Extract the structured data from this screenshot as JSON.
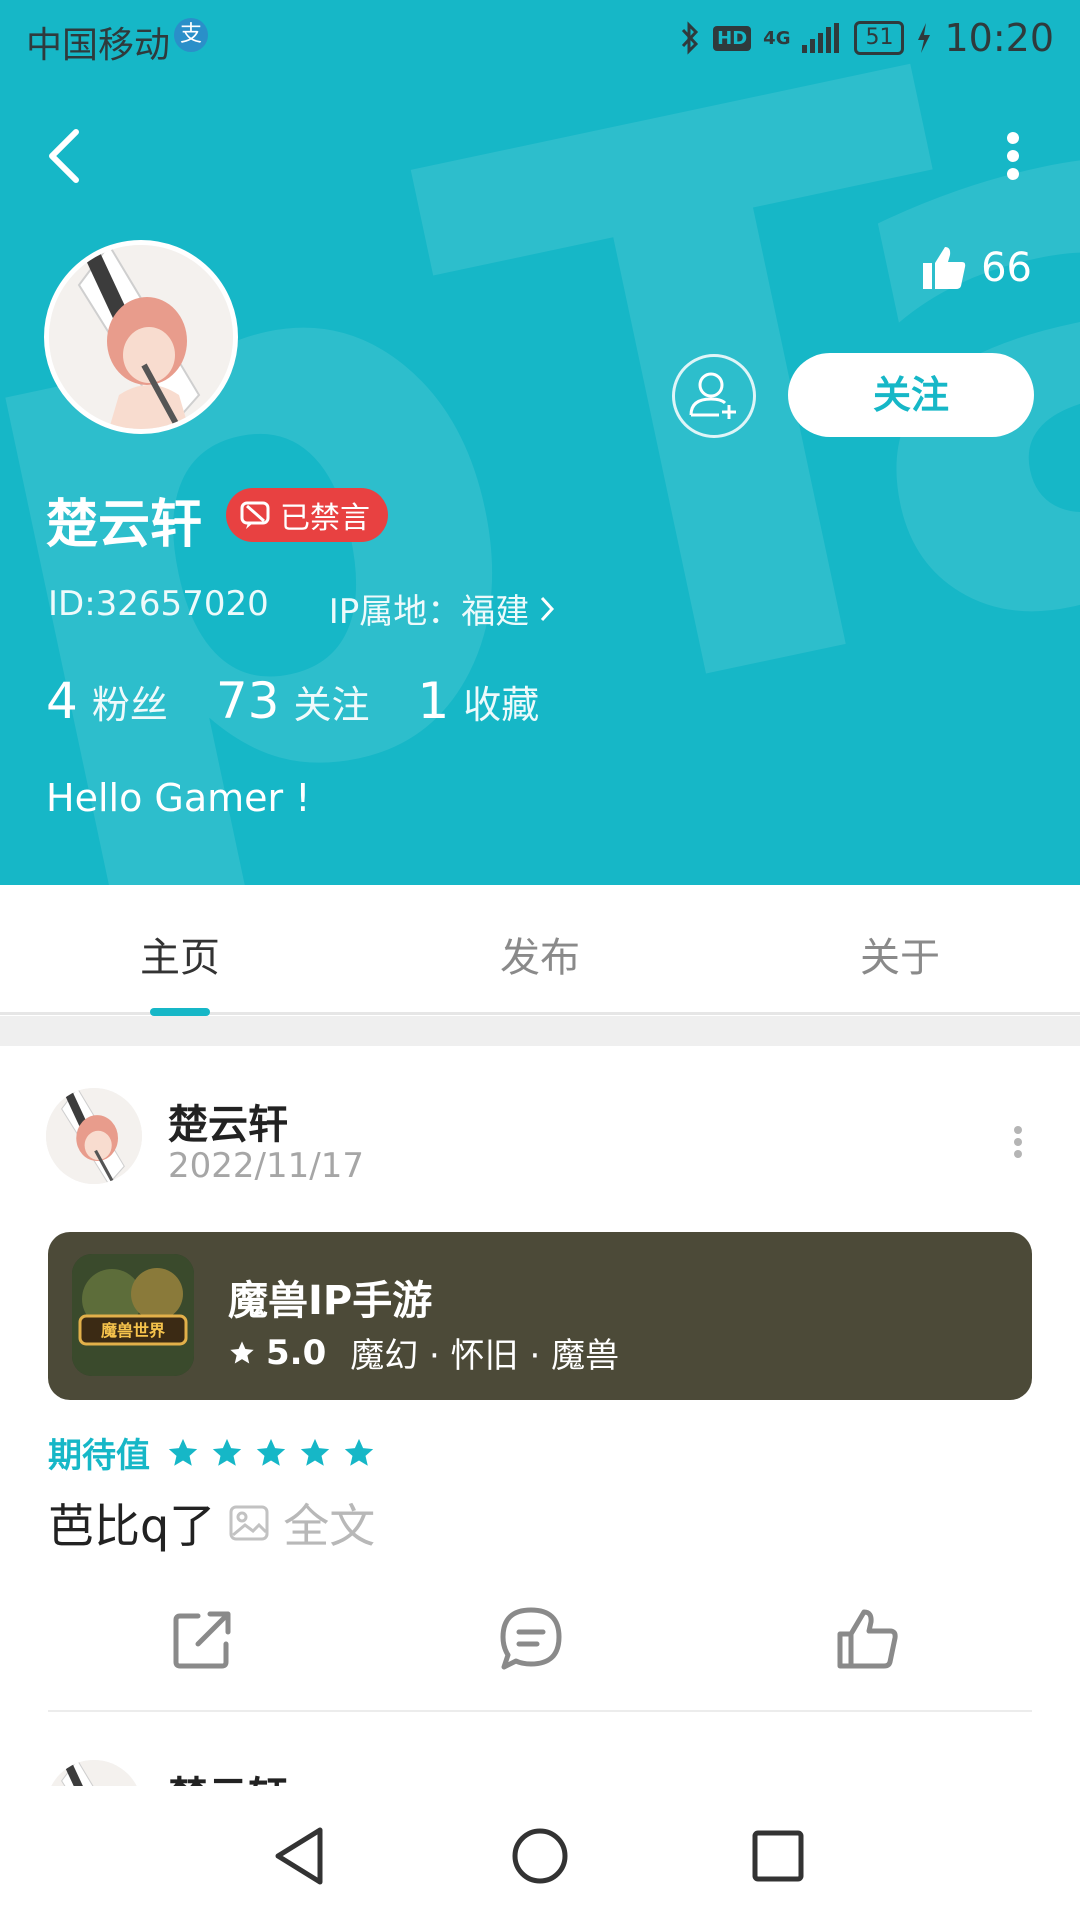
{
  "status_bar": {
    "carrier": "中国移动",
    "alipay_icon": "支",
    "hd": "HD",
    "network": "4G",
    "battery": "51",
    "time": "10:20"
  },
  "profile": {
    "likes": "66",
    "follow_label": "关注",
    "username": "楚云轩",
    "banned_badge": "已禁言",
    "id_text": "ID:32657020",
    "ip_text": "IP属地：福建",
    "stats": [
      {
        "num": "4",
        "label": "粉丝"
      },
      {
        "num": "73",
        "label": "关注"
      },
      {
        "num": "1",
        "label": "收藏"
      }
    ],
    "bio": "Hello Gamer !"
  },
  "tabs": [
    {
      "label": "主页",
      "active": true
    },
    {
      "label": "发布",
      "active": false
    },
    {
      "label": "关于",
      "active": false
    }
  ],
  "post": {
    "author": "楚云轩",
    "date": "2022/11/17",
    "game": {
      "title": "魔兽IP手游",
      "score": "5.0",
      "tags": "魔幻 · 怀旧 · 魔兽",
      "icon_text": "魔兽世界"
    },
    "expect_label": "期待值",
    "expect_stars": 5,
    "content": "芭比q了",
    "fulltext": "全文"
  },
  "next_post": {
    "author": "楚云轩"
  },
  "colors": {
    "accent": "#16b7c7",
    "banned": "#e84141",
    "game_card": "#4c4a38"
  },
  "icons": [
    "back-icon",
    "more-icon",
    "thumb-up-icon",
    "add-user-icon",
    "chat-ban-icon",
    "chevron-right-icon",
    "star-icon",
    "image-icon",
    "share-icon",
    "comment-icon",
    "like-icon",
    "nav-back-icon",
    "nav-home-icon",
    "nav-recents-icon"
  ]
}
